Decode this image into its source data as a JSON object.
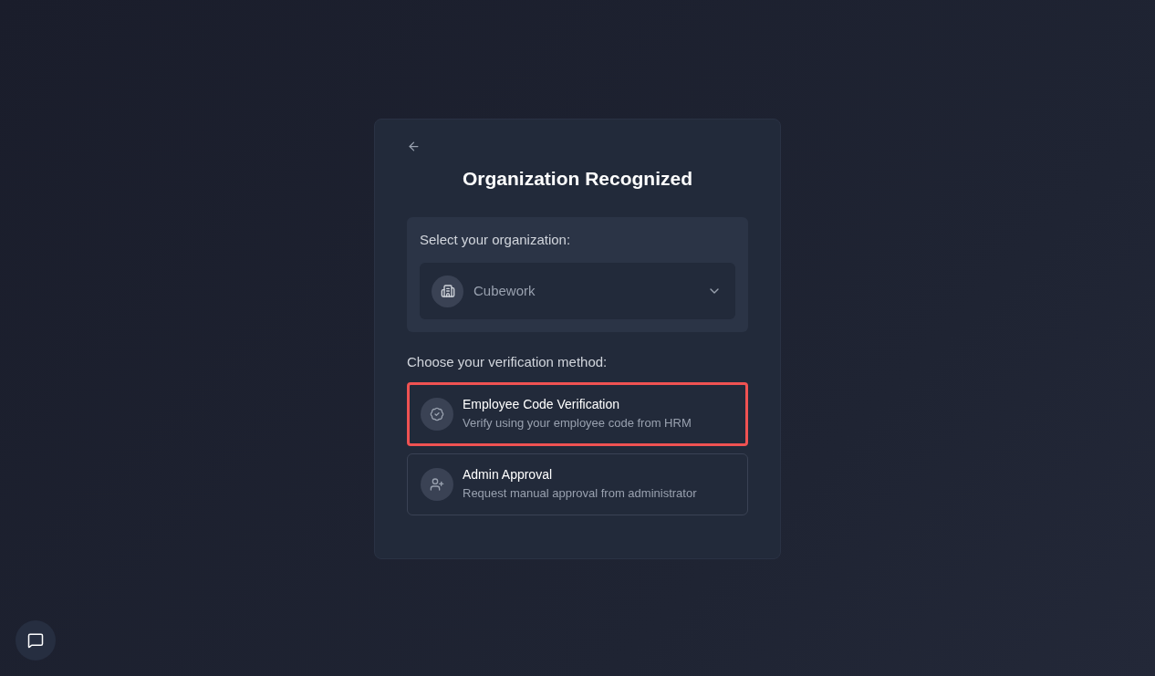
{
  "card": {
    "title": "Organization Recognized",
    "organization": {
      "label": "Select your organization:",
      "value": "Cubework"
    },
    "methods_label": "Choose your verification method:",
    "methods": [
      {
        "kind": "code",
        "title": "Employee Code Verification",
        "description": "Verify using your employee code from HRM",
        "selected": true
      },
      {
        "kind": "admin",
        "title": "Admin Approval",
        "description": "Request manual approval from administrator",
        "selected": false
      }
    ]
  }
}
